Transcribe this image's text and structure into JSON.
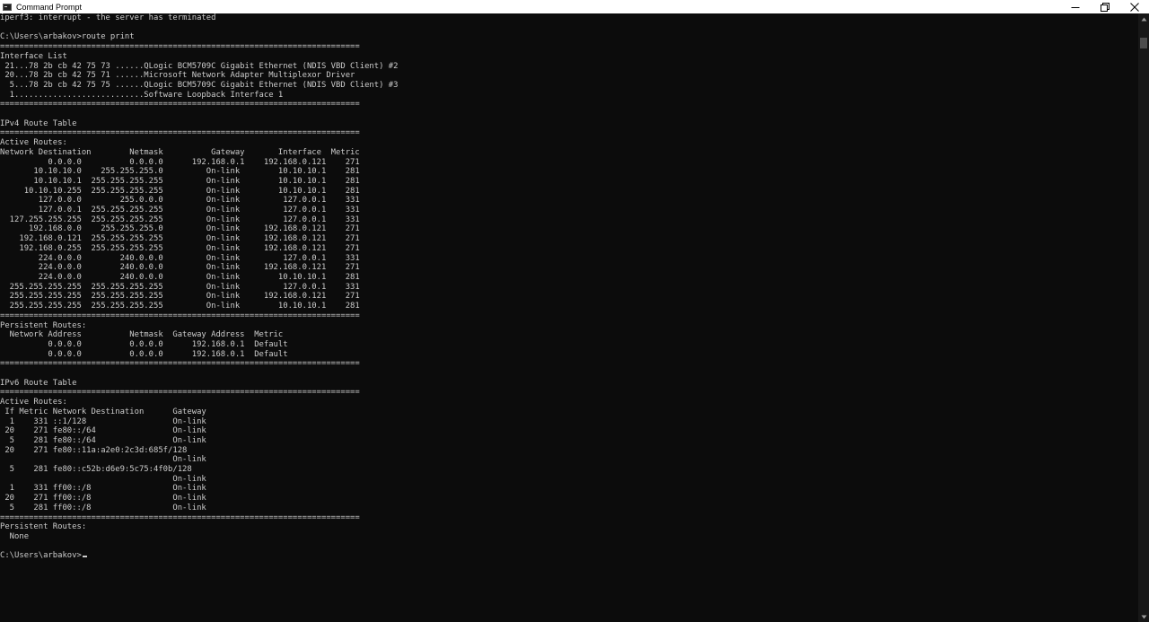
{
  "window": {
    "title": "Command Prompt",
    "colors": {
      "console_background": "#0c0c0c",
      "console_text": "#cccccc",
      "titlebar_background": "#ffffff"
    },
    "icons": [
      "command-prompt-icon",
      "minimize-icon",
      "maximize-icon",
      "close-icon",
      "scroll-up-arrow-icon",
      "scroll-down-arrow-icon"
    ]
  },
  "console": {
    "lines": [
      "iperf3: interrupt - the server has terminated",
      "",
      "C:\\Users\\arbakov>route print",
      "===========================================================================",
      "Interface List",
      " 21...78 2b cb 42 75 73 ......QLogic BCM5709C Gigabit Ethernet (NDIS VBD Client) #2",
      " 20...78 2b cb 42 75 71 ......Microsoft Network Adapter Multiplexor Driver",
      "  5...78 2b cb 42 75 75 ......QLogic BCM5709C Gigabit Ethernet (NDIS VBD Client) #3",
      "  1...........................Software Loopback Interface 1",
      "===========================================================================",
      "",
      "IPv4 Route Table",
      "===========================================================================",
      "Active Routes:",
      "Network Destination        Netmask          Gateway       Interface  Metric",
      "          0.0.0.0          0.0.0.0      192.168.0.1    192.168.0.121    271",
      "       10.10.10.0    255.255.255.0         On-link        10.10.10.1    281",
      "       10.10.10.1  255.255.255.255         On-link        10.10.10.1    281",
      "     10.10.10.255  255.255.255.255         On-link        10.10.10.1    281",
      "        127.0.0.0        255.0.0.0         On-link         127.0.0.1    331",
      "        127.0.0.1  255.255.255.255         On-link         127.0.0.1    331",
      "  127.255.255.255  255.255.255.255         On-link         127.0.0.1    331",
      "      192.168.0.0    255.255.255.0         On-link     192.168.0.121    271",
      "    192.168.0.121  255.255.255.255         On-link     192.168.0.121    271",
      "    192.168.0.255  255.255.255.255         On-link     192.168.0.121    271",
      "        224.0.0.0        240.0.0.0         On-link         127.0.0.1    331",
      "        224.0.0.0        240.0.0.0         On-link     192.168.0.121    271",
      "        224.0.0.0        240.0.0.0         On-link        10.10.10.1    281",
      "  255.255.255.255  255.255.255.255         On-link         127.0.0.1    331",
      "  255.255.255.255  255.255.255.255         On-link     192.168.0.121    271",
      "  255.255.255.255  255.255.255.255         On-link        10.10.10.1    281",
      "===========================================================================",
      "Persistent Routes:",
      "  Network Address          Netmask  Gateway Address  Metric",
      "          0.0.0.0          0.0.0.0      192.168.0.1  Default",
      "          0.0.0.0          0.0.0.0      192.168.0.1  Default",
      "===========================================================================",
      "",
      "IPv6 Route Table",
      "===========================================================================",
      "Active Routes:",
      " If Metric Network Destination      Gateway",
      "  1    331 ::1/128                  On-link",
      " 20    271 fe80::/64                On-link",
      "  5    281 fe80::/64                On-link",
      " 20    271 fe80::11a:a2e0:2c3d:685f/128",
      "                                    On-link",
      "  5    281 fe80::c52b:d6e9:5c75:4f0b/128",
      "                                    On-link",
      "  1    331 ff00::/8                 On-link",
      " 20    271 ff00::/8                 On-link",
      "  5    281 ff00::/8                 On-link",
      "===========================================================================",
      "Persistent Routes:",
      "  None",
      ""
    ],
    "prompt": "C:\\Users\\arbakov>"
  }
}
